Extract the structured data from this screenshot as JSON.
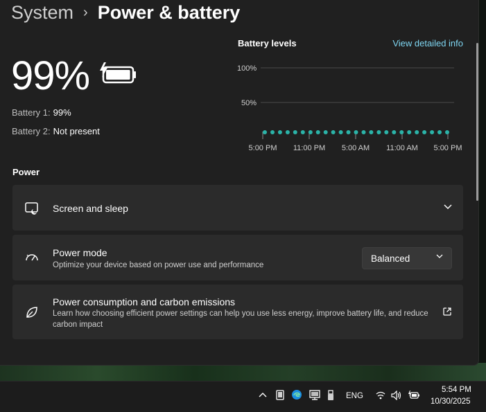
{
  "header": {
    "parent": "System",
    "separator": "›",
    "current": "Power & battery"
  },
  "battery": {
    "percent_label": "99%",
    "charge_fraction": 0.99,
    "rows": [
      {
        "label": "Battery 1:",
        "value": "99%"
      },
      {
        "label": "Battery 2:",
        "value": "Not present"
      }
    ]
  },
  "levels": {
    "title": "Battery levels",
    "link": "View detailed info"
  },
  "chart_data": {
    "type": "line",
    "title": "Battery levels",
    "x": [
      "5:00 PM",
      "",
      "",
      "",
      "",
      "",
      "",
      "",
      "",
      "",
      "",
      "",
      "",
      "",
      "",
      "",
      "",
      "",
      "",
      "",
      "",
      "",
      "",
      "",
      ""
    ],
    "tick_labels": [
      "5:00 PM",
      "11:00 PM",
      "5:00 AM",
      "11:00 AM",
      "5:00 PM"
    ],
    "y_tick_labels": [
      "100%",
      "50%"
    ],
    "ylim": [
      0,
      100
    ],
    "values": [
      7,
      7,
      7,
      7,
      7,
      7,
      7,
      7,
      7,
      7,
      7,
      7,
      7,
      7,
      7,
      7,
      7,
      7,
      7,
      7,
      7,
      7,
      7,
      7,
      7
    ],
    "grid": true
  },
  "power": {
    "section_title": "Power",
    "cards": [
      {
        "title": "Screen and sleep",
        "description": "",
        "icon": "screen-sleep-icon"
      },
      {
        "title": "Power mode",
        "description": "Optimize your device based on power use and performance",
        "icon": "power-mode-gauge-icon",
        "dropdown_value": "Balanced"
      },
      {
        "title": "Power consumption and carbon emissions",
        "description": "Learn how choosing efficient power settings can help you use less energy, improve battery life, and reduce carbon impact",
        "icon": "leaf-icon"
      }
    ]
  },
  "taskbar": {
    "language": "ENG",
    "time": "5:54 PM",
    "date": "10/30/2025",
    "tray_icons": [
      "chevron-up-icon",
      "tablet-icon",
      "edge-icon",
      "monitor-icon",
      "usb-icon",
      "wifi-icon",
      "volume-icon",
      "battery-charging-icon"
    ]
  },
  "colors": {
    "window_bg": "#202020",
    "card_bg": "#2b2b2b",
    "accent_link": "#7fd6f2",
    "chart_dot": "#2bb3a8"
  }
}
